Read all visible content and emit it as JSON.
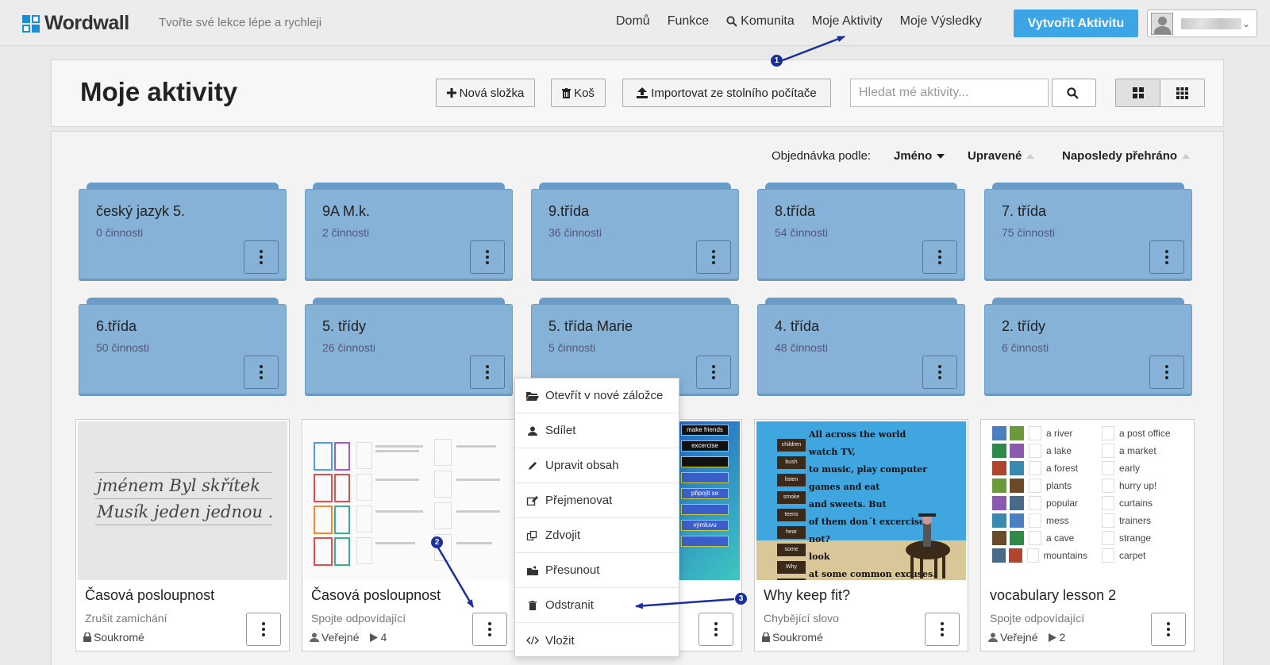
{
  "header": {
    "logo_text": "Wordwall",
    "tagline": "Tvořte své lekce lépe a rychleji",
    "nav": [
      "Domů",
      "Funkce",
      "Komunita",
      "Moje Aktivity",
      "Moje Výsledky"
    ],
    "create_label": "Vytvořit Aktivitu"
  },
  "page": {
    "title": "Moje aktivity",
    "new_folder_label": "Nová složka",
    "trash_label": "Koš",
    "import_label": "Importovat ze stolního počítače",
    "search_placeholder": "Hledat mé aktivity..."
  },
  "sort": {
    "label": "Objednávka podle:",
    "options": [
      "Jméno",
      "Upravené",
      "Naposledy přehráno"
    ],
    "active": "Jméno"
  },
  "folders": [
    {
      "name": "český jazyk 5.",
      "count": "0 činnosti"
    },
    {
      "name": "9A M.k.",
      "count": "2 činnosti"
    },
    {
      "name": "9.třída",
      "count": "36 činnosti"
    },
    {
      "name": "8.třída",
      "count": "54 činnosti"
    },
    {
      "name": "7. třída",
      "count": "75 činnosti"
    },
    {
      "name": "6.třída",
      "count": "50 činnosti"
    },
    {
      "name": "5. třídy",
      "count": "26 činnosti"
    },
    {
      "name": "5. třída Marie",
      "count": "5 činnosti"
    },
    {
      "name": "4. třída",
      "count": "48 činnosti"
    },
    {
      "name": "2. třídy",
      "count": "6 činnosti"
    }
  ],
  "cards": [
    {
      "title": "Časová posloupnost",
      "type": "Zrušit zamíchání",
      "visibility": "Soukromé",
      "plays": ""
    },
    {
      "title": "Časová posloupnost",
      "type": "Spojte odpovídající",
      "visibility": "Veřejné",
      "plays": "4"
    },
    {
      "title": "",
      "type": "",
      "visibility": "",
      "plays": ""
    },
    {
      "title": "Why keep fit?",
      "type": "Chybějící slovo",
      "visibility": "Soukromé",
      "plays": ""
    },
    {
      "title": "vocabulary lesson 2",
      "type": "Spojte odpovídající",
      "visibility": "Veřejné",
      "plays": "2"
    }
  ],
  "thumbs": {
    "card1_line1": "jménem Byl skřítek",
    "card1_line2": "Musík jeden jednou .",
    "card3_words": [
      "make friends",
      "excercise",
      "připojit se",
      "výmluvu"
    ],
    "card4_lines": [
      "All across the world",
      "watch TV,",
      "to music, play computer",
      "games and eat",
      "and sweets. But",
      "of them don´t excercise",
      "not?",
      "look",
      "at some common excuses."
    ],
    "card4_side": [
      "children",
      "bush",
      "listen",
      "smoke",
      "teens",
      "hear",
      "some",
      "Why",
      "Let's"
    ],
    "card5_col1": [
      "a river",
      "a lake",
      "a forest",
      "plants",
      "popular",
      "mess",
      "a cave",
      "mountains"
    ],
    "card5_col2": [
      "a post office",
      "a market",
      "early",
      "hurry up!",
      "curtains",
      "trainers",
      "strange",
      "carpet"
    ]
  },
  "menu": [
    {
      "label": "Otevřít v nové záložce",
      "icon": "folder-open-icon"
    },
    {
      "label": "Sdílet",
      "icon": "user-icon"
    },
    {
      "label": "Upravit obsah",
      "icon": "pencil-icon"
    },
    {
      "label": "Přejmenovat",
      "icon": "edit-icon"
    },
    {
      "label": "Zdvojit",
      "icon": "copy-icon"
    },
    {
      "label": "Přesunout",
      "icon": "move-icon"
    },
    {
      "label": "Odstranit",
      "icon": "trash-icon"
    },
    {
      "label": "Vložit",
      "icon": "code-icon"
    }
  ],
  "annotations": [
    "1",
    "2",
    "3"
  ],
  "colors": {
    "accent": "#3ba5e6",
    "folder": "#86b2d8",
    "annotation": "#1a2f9c"
  }
}
